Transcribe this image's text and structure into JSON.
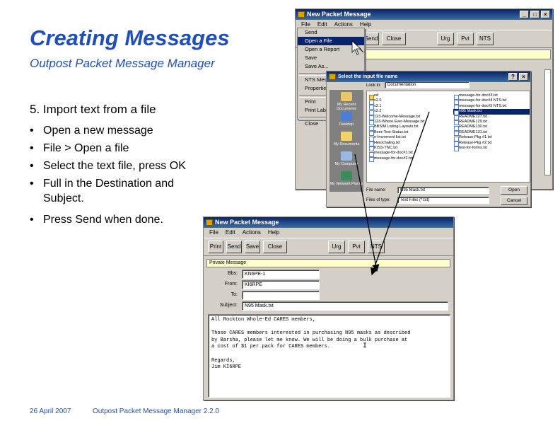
{
  "slide": {
    "title": "Creating Messages",
    "subtitle": "Outpost Packet Message Manager",
    "step_heading": "5. Import text from a file",
    "bullets": [
      "Open a new message",
      "File > Open a file",
      "Select the text file, press OK",
      "Full in the Destination and Subject.",
      "Press Send when done."
    ],
    "footer_date": "26 April 2007",
    "footer_product": "Outpost Packet Message Manager 2.2.0"
  },
  "window_top": {
    "title": "New Packet Message",
    "menu": [
      "File",
      "Edit",
      "Actions",
      "Help"
    ],
    "toolbar": [
      "Send",
      "Close",
      "Urg",
      "Pvt",
      "NTS"
    ],
    "file_menu": [
      "Send",
      "Open a File",
      "Open a Report",
      "Save",
      "Save As...",
      "NTS Message",
      "Properties",
      "Print",
      "Print Label",
      "Close"
    ]
  },
  "file_dialog": {
    "title": "Select the input file name",
    "look_in_label": "Look in:",
    "look_in_value": "Documentation",
    "places": [
      "My Recent Documents",
      "Desktop",
      "My Documents",
      "My Computer",
      "My Network Places"
    ],
    "files_col1": [
      "ed",
      "v2.0",
      "v2.1",
      "v2.2",
      "123-Welcome-Message.txt",
      "123-Where Ever-Message.txt",
      "BBSIM Listing Layouts.txt",
      "Beer-Test-Status.txt",
      "e-Increment list.txt",
      "Herochaling.txt",
      "KISS-TNC.txt",
      "message-for-doc#1.txt",
      "message-for-doc#2.txt"
    ],
    "files_col2": [
      "message-for-doc#3.txt",
      "message-for-doc#4 NTS.txt",
      "message-for-doc#5 NTS.txt",
      "N95 Mask.txt",
      "README127.txt",
      "README129.txt",
      "README130.txt",
      "README131.txt",
      "Release-Pkg #1.txt",
      "Release-Pkg #2.txt",
      "test-for-forms.txt"
    ],
    "selected_file": "N95 Mask.txt",
    "file_name_label": "File name:",
    "file_name_value": "N95 Mask.txt",
    "files_of_type_label": "Files of type:",
    "files_of_type_value": "Text Files (*.txt)",
    "open_label": "Open",
    "cancel_label": "Cancel"
  },
  "window_bottom": {
    "title": "New Packet Message",
    "menu": [
      "File",
      "Edit",
      "Actions",
      "Help"
    ],
    "toolbar": [
      "Print",
      "Send",
      "Save",
      "Close",
      "Urg",
      "Pvt",
      "NTS"
    ],
    "message_type": "Private Message",
    "bbs_label": "Bbs:",
    "bbs_value": "KN6PE-1",
    "from_label": "From:",
    "from_value": "KI6RPE",
    "to_label": "To:",
    "to_value": "",
    "subject_label": "Subject:",
    "subject_value": "N95 Mask.txt",
    "body_lines": [
      "All Rockton Whole-Ed CARES members,",
      "",
      "Those CARES members interested in purchasing N95 masks as described",
      "by Barsha, please let me know. We will be doing a bulk purchase at",
      "a cost of $1 per pack for CARES members.",
      "",
      "Regards,",
      "Jim KI6RPE"
    ]
  },
  "colors": {
    "accent": "#1f4fb7",
    "titlebar": "#0a246a",
    "window_bg": "#d4d0c8"
  }
}
